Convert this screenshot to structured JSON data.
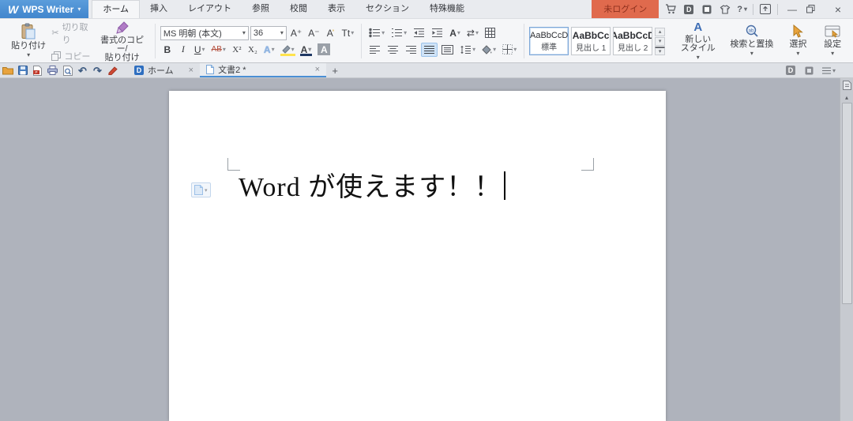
{
  "icons": {
    "logo_w": "W",
    "caret": "▾",
    "caret_up": "▴",
    "help": "?",
    "minimize": "—",
    "close": "×",
    "plus": "+",
    "scissors": "✂",
    "undo": "↶",
    "redo": "↷",
    "swap": "⇄",
    "ring": "˚",
    "docer_d": "D"
  },
  "colors": {
    "titlebar_blue": "#4a8fd4",
    "accent_blue": "#4a8fd4",
    "login_bg": "#e06a4d",
    "highlight_yellow": "#ffe34d"
  },
  "titlebar": {
    "app_name": "WPS Writer",
    "login": "未ログイン",
    "tabs": [
      {
        "label": "ホーム"
      },
      {
        "label": "挿入"
      },
      {
        "label": "レイアウト"
      },
      {
        "label": "参照"
      },
      {
        "label": "校閲"
      },
      {
        "label": "表示"
      },
      {
        "label": "セクション"
      },
      {
        "label": "特殊機能"
      }
    ]
  },
  "ribbon": {
    "clipboard": {
      "paste": "貼り付け",
      "cut": "切り取り",
      "copy": "コピー",
      "format_painter1": "書式のコピー/",
      "format_painter2": "貼り付け"
    },
    "font": {
      "family": "MS 明朝 (本文)",
      "size": "36",
      "grow": "A⁺",
      "shrink": "A⁻",
      "letter_a": "A",
      "case_label": "Tt",
      "bold": "B",
      "italic": "I",
      "underline": "U",
      "strike": "AB",
      "superscript": "X²",
      "subscript": "X₂"
    },
    "styles": [
      {
        "preview": "AaBbCcD",
        "name": "標準"
      },
      {
        "preview": "AaBbCc",
        "name": "見出し 1"
      },
      {
        "preview": "AaBbCcD",
        "name": "見出し 2"
      }
    ],
    "tools": {
      "new_style1": "新しい",
      "new_style2": "スタイル",
      "find_replace": "検索と置換",
      "select": "選択",
      "settings": "設定"
    }
  },
  "tabbar": {
    "home_tab": "ホーム",
    "doc_tab": "文書2 *"
  },
  "document": {
    "text": "Word が使えます！！"
  }
}
